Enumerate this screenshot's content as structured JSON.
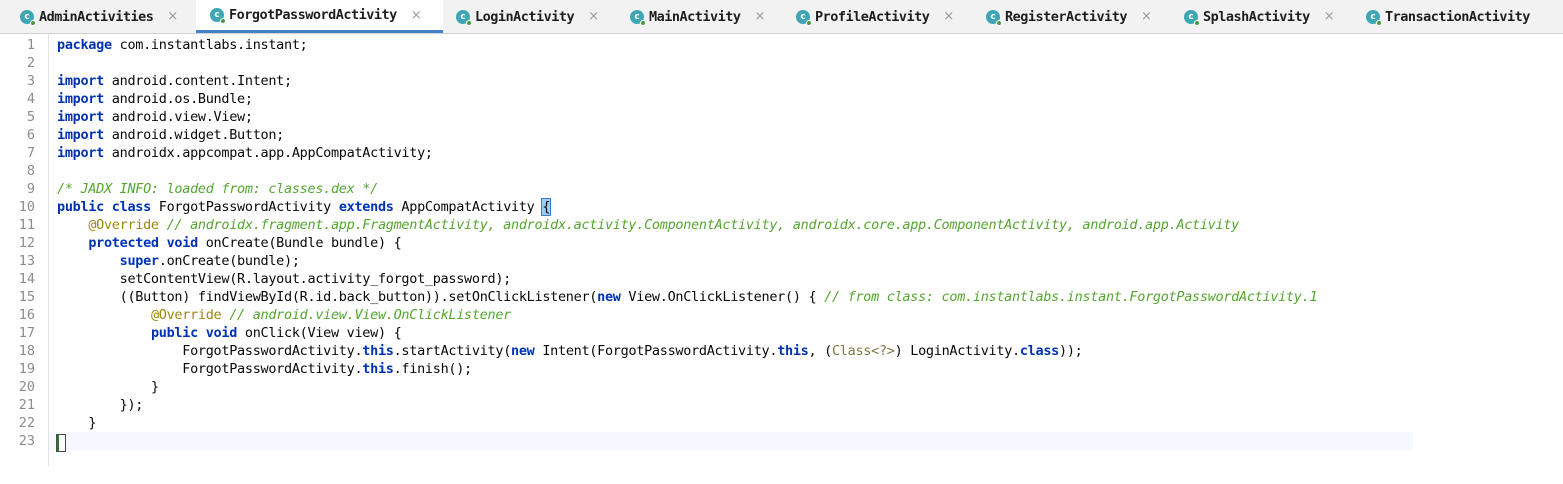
{
  "tabs": [
    {
      "label": "AdminActivities",
      "active": false
    },
    {
      "label": "ForgotPasswordActivity",
      "active": true
    },
    {
      "label": "LoginActivity",
      "active": false
    },
    {
      "label": "MainActivity",
      "active": false
    },
    {
      "label": "ProfileActivity",
      "active": false
    },
    {
      "label": "RegisterActivity",
      "active": false
    },
    {
      "label": "SplashActivity",
      "active": false
    },
    {
      "label": "TransactionActivity",
      "active": false
    }
  ],
  "tab_icon_letter": "c",
  "close_glyph": "×",
  "line_numbers": [
    "1",
    "2",
    "3",
    "4",
    "5",
    "6",
    "7",
    "8",
    "9",
    "10",
    "11",
    "12",
    "13",
    "14",
    "15",
    "16",
    "17",
    "18",
    "19",
    "20",
    "21",
    "22",
    "23"
  ],
  "code": {
    "l1_kw": "package",
    "l1": " com.instantlabs.instant;",
    "l3_kw": "import",
    "l3": " android.content.Intent;",
    "l4_kw": "import",
    "l4": " android.os.Bundle;",
    "l5_kw": "import",
    "l5": " android.view.View;",
    "l6_kw": "import",
    "l6": " android.widget.Button;",
    "l7_kw": "import",
    "l7": " androidx.appcompat.app.AppCompatActivity;",
    "l9_cm": "/* JADX INFO: loaded from: classes.dex */",
    "l10_kw1": "public",
    "l10_kw2": "class",
    "l10_a": " ForgotPasswordActivity ",
    "l10_kw3": "extends",
    "l10_b": " AppCompatActivity ",
    "l10_brace": "{",
    "l11_an": "@Override",
    "l11_cm": " // androidx.fragment.app.FragmentActivity, androidx.activity.ComponentActivity, androidx.core.app.ComponentActivity, android.app.Activity",
    "l12_kw1": "protected",
    "l12_kw2": "void",
    "l12": " onCreate(Bundle bundle) {",
    "l13_kw": "super",
    "l13": ".onCreate(bundle);",
    "l14": "setContentView(R.layout.activity_forgot_password);",
    "l15_a": "((Button) findViewById(R.id.back_button)).setOnClickListener(",
    "l15_kw": "new",
    "l15_b": " View.OnClickListener() { ",
    "l15_cm": "// from class: com.instantlabs.instant.ForgotPasswordActivity.1",
    "l16_an": "@Override",
    "l16_cm": " // android.view.View.OnClickListener",
    "l17_kw1": "public",
    "l17_kw2": "void",
    "l17": " onClick(View view) {",
    "l18_a": "ForgotPasswordActivity.",
    "l18_kw1": "this",
    "l18_b": ".startActivity(",
    "l18_kw2": "new",
    "l18_c": " Intent(ForgotPasswordActivity.",
    "l18_kw3": "this",
    "l18_d": ", (",
    "l18_cls": "Class<?>",
    "l18_e": ") LoginActivity.",
    "l18_kw4": "class",
    "l18_f": "));",
    "l19_a": "ForgotPasswordActivity.",
    "l19_kw": "this",
    "l19_b": ".finish();",
    "l20": "}",
    "l21": "});",
    "l22": "}"
  },
  "colors": {
    "keyword": "#0033b3",
    "comment": "#55a630",
    "annotation": "#9e880d",
    "active_tab_underline": "#4083c9"
  }
}
